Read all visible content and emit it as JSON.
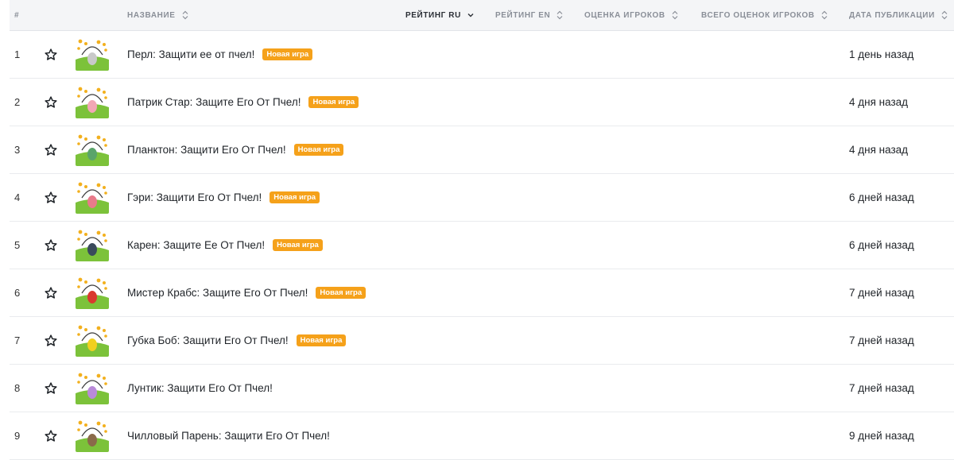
{
  "header": {
    "rank": "#",
    "name": "НАЗВАНИЕ",
    "rating_ru": "РЕЙТИНГ RU",
    "rating_en": "РЕЙТИНГ EN",
    "player_score": "ОЦЕНКА ИГРОКОВ",
    "total_scores": "ВСЕГО ОЦЕНОК ИГРОКОВ",
    "published": "ДАТА ПУБЛИКАЦИИ"
  },
  "colors": {
    "badge": "#f5a11a",
    "header_bg": "#f4f5f7"
  },
  "rows": [
    {
      "rank": "1",
      "title": "Перл: Защити ее от пчел!",
      "badge": "Новая игра",
      "date": "1 день назад",
      "char": "#c9c9c9"
    },
    {
      "rank": "2",
      "title": "Патрик Стар: Защите Его От Пчел!",
      "badge": "Новая игра",
      "date": "4 дня назад",
      "char": "#f2a7b5"
    },
    {
      "rank": "3",
      "title": "Планктон: Защити Его От Пчел!",
      "badge": "Новая игра",
      "date": "4 дня назад",
      "char": "#5aa46a"
    },
    {
      "rank": "4",
      "title": "Гэри: Защити Его От Пчел!",
      "badge": "Новая игра",
      "date": "6 дней назад",
      "char": "#e87a8a"
    },
    {
      "rank": "5",
      "title": "Карен: Защите Ее От Пчел!",
      "badge": "Новая игра",
      "date": "6 дней назад",
      "char": "#3a4a5c"
    },
    {
      "rank": "6",
      "title": "Мистер Крабс: Защите Его От Пчел!",
      "badge": "Новая игра",
      "date": "7 дней назад",
      "char": "#d93a2e"
    },
    {
      "rank": "7",
      "title": "Губка Боб: Защити Его От Пчел!",
      "badge": "Новая игра",
      "date": "7 дней назад",
      "char": "#f0d020"
    },
    {
      "rank": "8",
      "title": "Лунтик: Защити Его От Пчел!",
      "badge": "",
      "date": "7 дней назад",
      "char": "#b98ad8"
    },
    {
      "rank": "9",
      "title": "Чилловый Парень: Защити Его От Пчел!",
      "badge": "",
      "date": "9 дней назад",
      "char": "#8a6a4a"
    }
  ]
}
